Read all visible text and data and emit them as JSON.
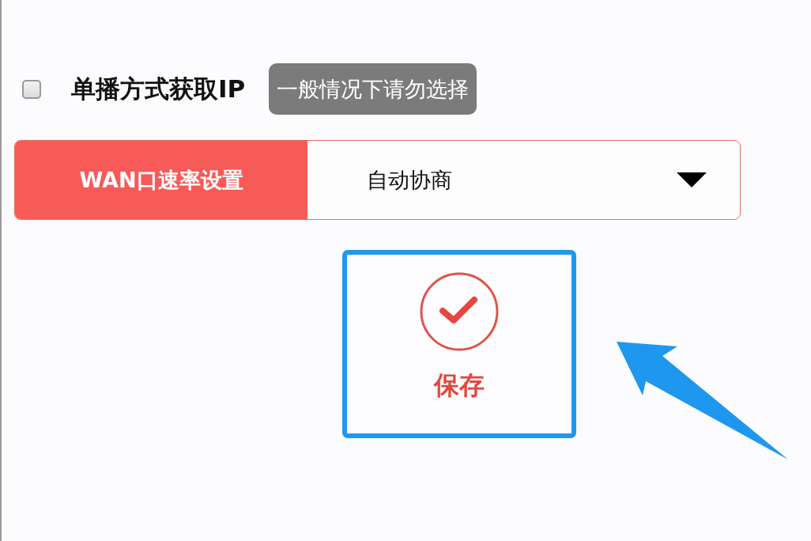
{
  "option": {
    "label": "单播方式获取IP",
    "checked": false,
    "hint": "一般情况下请勿选择"
  },
  "wan_rate": {
    "label": "WAN口速率设置",
    "value": "自动协商"
  },
  "save_button": {
    "label": "保存"
  }
}
